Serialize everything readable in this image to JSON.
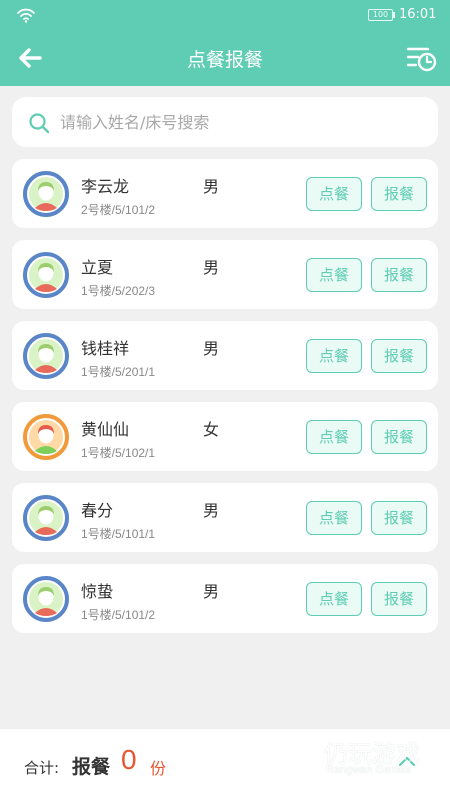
{
  "status_bar": {
    "battery": "100",
    "time": "16:01"
  },
  "header": {
    "title": "点餐报餐"
  },
  "search": {
    "placeholder": "请输入姓名/床号搜索"
  },
  "colors": {
    "primary": "#5fcdb3",
    "accent": "#e8552f",
    "avatar_male_ring": "#5a86c8",
    "avatar_female_ring": "#f09a3b"
  },
  "residents": [
    {
      "name": "李云龙",
      "gender": "男",
      "address": "2号楼/5/101/2",
      "avatar": "avatar-male-icon",
      "order_label": "点餐",
      "report_label": "报餐"
    },
    {
      "name": "立夏",
      "gender": "男",
      "address": "1号楼/5/202/3",
      "avatar": "avatar-male-icon",
      "order_label": "点餐",
      "report_label": "报餐"
    },
    {
      "name": "钱桂祥",
      "gender": "男",
      "address": "1号楼/5/201/1",
      "avatar": "avatar-male-icon",
      "order_label": "点餐",
      "report_label": "报餐"
    },
    {
      "name": "黄仙仙",
      "gender": "女",
      "address": "1号楼/5/102/1",
      "avatar": "avatar-female-icon",
      "order_label": "点餐",
      "report_label": "报餐"
    },
    {
      "name": "春分",
      "gender": "男",
      "address": "1号楼/5/101/1",
      "avatar": "avatar-male-icon",
      "order_label": "点餐",
      "report_label": "报餐"
    },
    {
      "name": "惊蛰",
      "gender": "男",
      "address": "1号楼/5/101/2",
      "avatar": "avatar-male-icon",
      "order_label": "点餐",
      "report_label": "报餐"
    }
  ],
  "footer": {
    "total_label": "合计:",
    "type_label": "报餐",
    "count": "0",
    "unit": "份"
  },
  "watermark": {
    "text_cn": "仍玩游戏",
    "text_en": "Rengwan Games"
  }
}
